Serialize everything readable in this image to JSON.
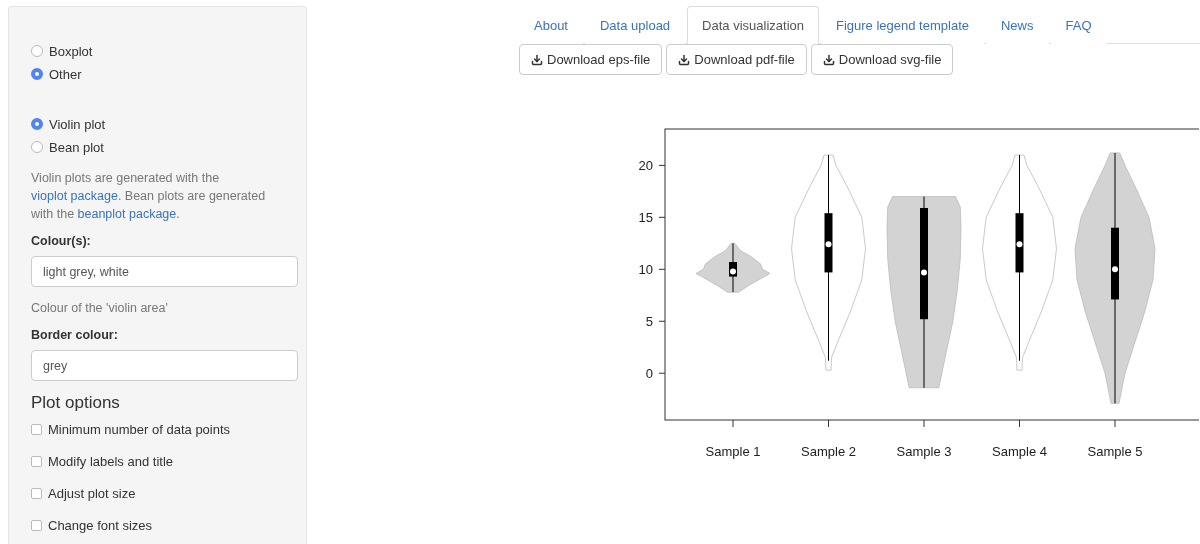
{
  "sidebar": {
    "plot_type": [
      {
        "label": "Boxplot",
        "selected": false
      },
      {
        "label": "Other",
        "selected": true
      }
    ],
    "other_type": [
      {
        "label": "Violin plot",
        "selected": true
      },
      {
        "label": "Bean plot",
        "selected": false
      }
    ],
    "help_text": [
      {
        "text": "Violin plots are generated with the ",
        "link": false
      },
      {
        "text": "vioplot package",
        "link": true
      },
      {
        "text": ". Bean plots are generated with the ",
        "link": false
      },
      {
        "text": "beanplot package",
        "link": true
      },
      {
        "text": ".",
        "link": false
      }
    ],
    "colours": {
      "label": "Colour(s):",
      "value": "light grey, white",
      "hint": "Colour of the 'violin area'"
    },
    "border": {
      "label": "Border colour:",
      "value": "grey"
    },
    "plot_options": {
      "title": "Plot options",
      "items": [
        {
          "label": "Minimum number of data points",
          "checked": false
        },
        {
          "label": "Modify labels and title",
          "checked": false
        },
        {
          "label": "Adjust plot size",
          "checked": false
        },
        {
          "label": "Change font sizes",
          "checked": false
        }
      ]
    }
  },
  "tabs": [
    {
      "label": "About",
      "selected": false
    },
    {
      "label": "Data upload",
      "selected": false
    },
    {
      "label": "Data visualization",
      "selected": true
    },
    {
      "label": "Figure legend template",
      "selected": false
    },
    {
      "label": "News",
      "selected": false
    },
    {
      "label": "FAQ",
      "selected": false
    }
  ],
  "downloads": [
    "Download eps-file",
    "Download pdf-file",
    "Download svg-file"
  ],
  "plot": {
    "kind": "picture",
    "y_ticks": [
      "20",
      "15",
      "10",
      "5",
      "0"
    ],
    "samples": [
      {
        "label": "Sample 1",
        "color": "#d3d3d3"
      },
      {
        "label": "Sample 2",
        "color": "#ffffff"
      },
      {
        "label": "Sample 3",
        "color": "#d3d3d3"
      },
      {
        "label": "Sample 4",
        "color": "#ffffff"
      },
      {
        "label": "Sample 5",
        "color": "#d3d3d3"
      }
    ]
  }
}
